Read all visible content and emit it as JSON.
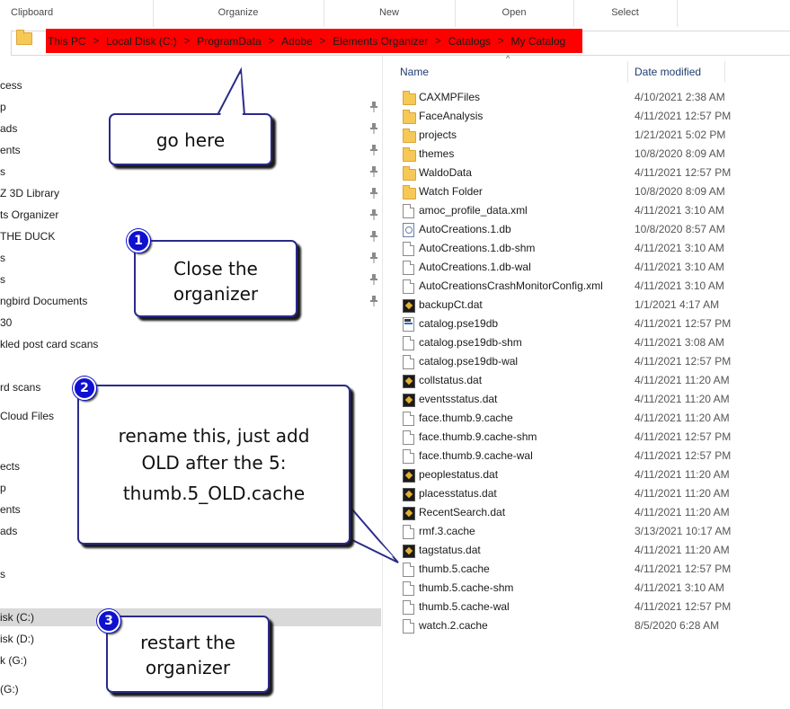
{
  "ribbon": {
    "groups": [
      "Clipboard",
      "Organize",
      "New",
      "Open",
      "Select"
    ]
  },
  "address": {
    "crumbs": [
      "This PC",
      "Local Disk (C:)",
      "ProgramData",
      "Adobe",
      "Elements Organizer",
      "Catalogs",
      "My Catalog"
    ],
    "separator": ">",
    "highlight_color": "#ff0000"
  },
  "nav": {
    "items": [
      {
        "label": "cess",
        "pinned": false,
        "selected": false
      },
      {
        "label": "p",
        "pinned": true,
        "selected": false
      },
      {
        "label": "ads",
        "pinned": true,
        "selected": false
      },
      {
        "label": "ents",
        "pinned": true,
        "selected": false
      },
      {
        "label": "s",
        "pinned": true,
        "selected": false
      },
      {
        "label": "Z 3D Library",
        "pinned": true,
        "selected": false
      },
      {
        "label": "ts Organizer",
        "pinned": true,
        "selected": false
      },
      {
        "label": " THE DUCK",
        "pinned": true,
        "selected": false
      },
      {
        "label": "s",
        "pinned": true,
        "selected": false
      },
      {
        "label": "s",
        "pinned": true,
        "selected": false
      },
      {
        "label": "ngbird Documents",
        "pinned": true,
        "selected": false
      },
      {
        "label": "30",
        "pinned": false,
        "selected": false
      },
      {
        "label": "kled post card scans",
        "pinned": false,
        "selected": false
      },
      {
        "label": "rd scans",
        "pinned": false,
        "selected": false
      },
      {
        "label": "Cloud Files",
        "pinned": false,
        "selected": false
      },
      {
        "label": "ects",
        "pinned": false,
        "selected": false
      },
      {
        "label": "p",
        "pinned": false,
        "selected": false
      },
      {
        "label": "ents",
        "pinned": false,
        "selected": false
      },
      {
        "label": "ads",
        "pinned": false,
        "selected": false
      },
      {
        "label": "s",
        "pinned": false,
        "selected": false
      },
      {
        "label": "isk (C:)",
        "pinned": false,
        "selected": true
      },
      {
        "label": "isk (D:)",
        "pinned": false,
        "selected": false
      },
      {
        "label": "k (G:)",
        "pinned": false,
        "selected": false
      },
      {
        "label": "(G:)",
        "pinned": false,
        "selected": false
      }
    ]
  },
  "list": {
    "col_name": "Name",
    "col_date": "Date modified",
    "sort_glyph": "^",
    "files": [
      {
        "name": "CAXMPFiles",
        "date": "4/10/2021 2:38 AM",
        "icon": "folder-icon"
      },
      {
        "name": "FaceAnalysis",
        "date": "4/11/2021 12:57 PM",
        "icon": "folder-icon"
      },
      {
        "name": "projects",
        "date": "1/21/2021 5:02 PM",
        "icon": "folder-icon"
      },
      {
        "name": "themes",
        "date": "10/8/2020 8:09 AM",
        "icon": "folder-icon"
      },
      {
        "name": "WaldoData",
        "date": "4/11/2021 12:57 PM",
        "icon": "folder-icon"
      },
      {
        "name": "Watch Folder",
        "date": "10/8/2020 8:09 AM",
        "icon": "folder-icon"
      },
      {
        "name": "amoc_profile_data.xml",
        "date": "4/11/2021 3:10 AM",
        "icon": "document-icon"
      },
      {
        "name": "AutoCreations.1.db",
        "date": "10/8/2020 8:57 AM",
        "icon": "database-icon"
      },
      {
        "name": "AutoCreations.1.db-shm",
        "date": "4/11/2021 3:10 AM",
        "icon": "document-icon"
      },
      {
        "name": "AutoCreations.1.db-wal",
        "date": "4/11/2021 3:10 AM",
        "icon": "document-icon"
      },
      {
        "name": "AutoCreationsCrashMonitorConfig.xml",
        "date": "4/11/2021 3:10 AM",
        "icon": "document-icon"
      },
      {
        "name": "backupCt.dat",
        "date": "1/1/2021 4:17 AM",
        "icon": "app-file-icon"
      },
      {
        "name": "catalog.pse19db",
        "date": "4/11/2021 12:57 PM",
        "icon": "catalog-file-icon"
      },
      {
        "name": "catalog.pse19db-shm",
        "date": "4/11/2021 3:08 AM",
        "icon": "document-icon"
      },
      {
        "name": "catalog.pse19db-wal",
        "date": "4/11/2021 12:57 PM",
        "icon": "document-icon"
      },
      {
        "name": "collstatus.dat",
        "date": "4/11/2021 11:20 AM",
        "icon": "app-file-icon"
      },
      {
        "name": "eventsstatus.dat",
        "date": "4/11/2021 11:20 AM",
        "icon": "app-file-icon"
      },
      {
        "name": "face.thumb.9.cache",
        "date": "4/11/2021 11:20 AM",
        "icon": "document-icon"
      },
      {
        "name": "face.thumb.9.cache-shm",
        "date": "4/11/2021 12:57 PM",
        "icon": "document-icon"
      },
      {
        "name": "face.thumb.9.cache-wal",
        "date": "4/11/2021 12:57 PM",
        "icon": "document-icon"
      },
      {
        "name": "peoplestatus.dat",
        "date": "4/11/2021 11:20 AM",
        "icon": "app-file-icon"
      },
      {
        "name": "placesstatus.dat",
        "date": "4/11/2021 11:20 AM",
        "icon": "app-file-icon"
      },
      {
        "name": "RecentSearch.dat",
        "date": "4/11/2021 11:20 AM",
        "icon": "app-file-icon"
      },
      {
        "name": "rmf.3.cache",
        "date": "3/13/2021 10:17 AM",
        "icon": "document-icon"
      },
      {
        "name": "tagstatus.dat",
        "date": "4/11/2021 11:20 AM",
        "icon": "app-file-icon"
      },
      {
        "name": "thumb.5.cache",
        "date": "4/11/2021 12:57 PM",
        "icon": "document-icon"
      },
      {
        "name": "thumb.5.cache-shm",
        "date": "4/11/2021 3:10 AM",
        "icon": "document-icon"
      },
      {
        "name": "thumb.5.cache-wal",
        "date": "4/11/2021 12:57 PM",
        "icon": "document-icon"
      },
      {
        "name": "watch.2.cache",
        "date": "8/5/2020 6:28 AM",
        "icon": "document-icon"
      }
    ]
  },
  "callouts": {
    "go_here": "go here",
    "step1_number": "1",
    "step1_line1": "Close the",
    "step1_line2": "organizer",
    "step2_number": "2",
    "step2_line1": "rename this, just add",
    "step2_line2": "OLD after the 5:",
    "step2_line3": "thumb.5_OLD.cache",
    "step3_number": "3",
    "step3_line1": "restart the",
    "step3_line2": "organizer"
  }
}
